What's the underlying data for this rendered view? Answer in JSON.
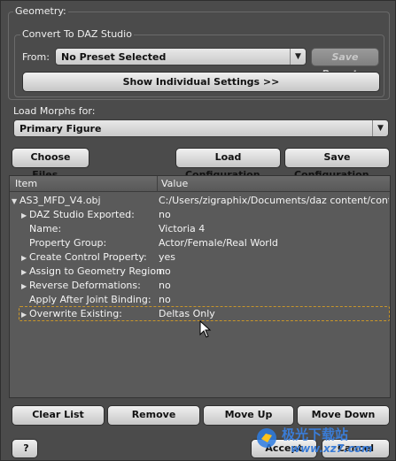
{
  "geometry_group": {
    "title": "Geometry:"
  },
  "convert_group": {
    "title": "Convert To DAZ Studio"
  },
  "from": {
    "label": "From:",
    "preset_value": "No Preset Selected",
    "save_preset_label": "Save Preset..."
  },
  "individual_settings_label": "Show Individual Settings >>",
  "load_morphs": {
    "label": "Load Morphs for:",
    "value": "Primary Figure"
  },
  "toolbar": {
    "choose_files": "Choose Files...",
    "load_config": "Load Configuration...",
    "save_config": "Save Configuration..."
  },
  "tree": {
    "columns": [
      "Item",
      "Value"
    ],
    "rows": [
      {
        "name": "AS3_MFD_V4.obj",
        "value": "C:/Users/zigraphix/Documents/daz content/content_...",
        "expander": "down"
      },
      {
        "name": "DAZ Studio Exported:",
        "value": "no",
        "expander": "right"
      },
      {
        "name": "Name:",
        "value": "Victoria 4",
        "expander": ""
      },
      {
        "name": "Property Group:",
        "value": "Actor/Female/Real World",
        "expander": ""
      },
      {
        "name": "Create Control Property:",
        "value": "yes",
        "expander": "right"
      },
      {
        "name": "Assign to Geometry Region:",
        "value": "no",
        "expander": "right"
      },
      {
        "name": "Reverse Deformations:",
        "value": "no",
        "expander": "right"
      },
      {
        "name": "Apply After Joint Binding:",
        "value": "no",
        "expander": ""
      },
      {
        "name": "Overwrite Existing:",
        "value": "Deltas Only",
        "expander": "right"
      }
    ]
  },
  "list_actions": {
    "clear": "Clear List",
    "remove": "Remove",
    "move_up": "Move Up",
    "move_down": "Move Down"
  },
  "footer": {
    "help": "?",
    "accept": "Accept",
    "cancel": "Cancel"
  },
  "watermark": {
    "line1": "极光下载站",
    "line2": "www.xz7.com"
  },
  "colors": {
    "dialog_bg": "#4b4b4b",
    "tree_bg": "#5a5a5a",
    "selection_outline": "#c9962a",
    "watermark_blue": "#3a7cd6"
  }
}
